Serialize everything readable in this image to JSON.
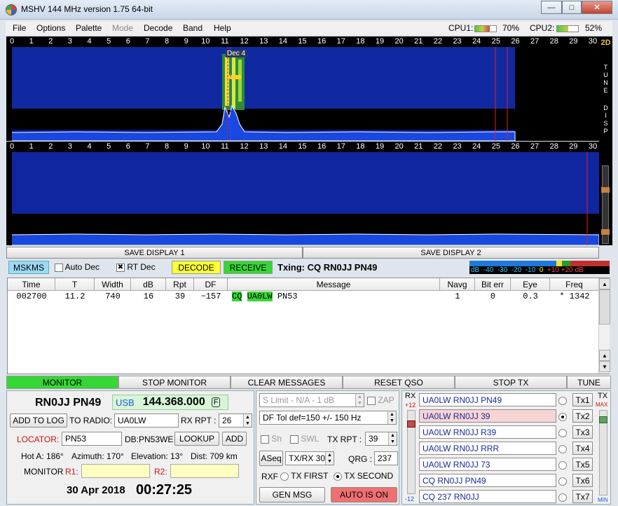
{
  "window": {
    "title": "MSHV 144 MHz version 1.75 64-bit"
  },
  "menu": [
    "File",
    "Options",
    "Palette",
    "Mode",
    "Decode",
    "Band",
    "Help"
  ],
  "cpu": {
    "cpu1_label": "CPU1:",
    "cpu1_value": "70%",
    "cpu1_level": 0.7,
    "cpu2_label": "CPU2:",
    "cpu2_value": "52%",
    "cpu2_level": 0.52
  },
  "scale": {
    "ticks": [
      "0",
      "1",
      "2",
      "3",
      "4",
      "5",
      "6",
      "7",
      "8",
      "9",
      "10",
      "11",
      "12",
      "13",
      "14",
      "15",
      "16",
      "17",
      "18",
      "19",
      "20",
      "21",
      "22",
      "23",
      "24",
      "25",
      "26",
      "27",
      "28",
      "29",
      "30"
    ]
  },
  "display1": {
    "decode_marker": "Dec 4"
  },
  "side_panel": {
    "mode_2d": "2D",
    "tune_letters": [
      "T",
      "U",
      "N",
      "E"
    ],
    "disp_letters": [
      "D",
      "I",
      "S",
      "P"
    ]
  },
  "save": {
    "display1": "SAVE DISPLAY 1",
    "display2": "SAVE DISPLAY 2"
  },
  "controls": {
    "mode": "MSKMS",
    "auto_dec": "Auto Dec",
    "auto_dec_checked": false,
    "rt_dec": "RT Dec",
    "rt_dec_checked": true,
    "decode": "DECODE",
    "receive": "RECEIVE",
    "txing": "Txing: CQ RN0JJ PN49"
  },
  "dbscale": {
    "labels": [
      "dB",
      "-40",
      "-30",
      "-20",
      "-10",
      "0",
      "+10",
      "+20 dB"
    ]
  },
  "table": {
    "headers": [
      "Time",
      "T",
      "Width",
      "dB",
      "Rpt",
      "DF",
      "Message",
      "Navg",
      "Bit err",
      "Eye",
      "Freq"
    ],
    "rows": [
      {
        "time": "002700",
        "t": "11.2",
        "width": "740",
        "db": "16",
        "rpt": "39",
        "df": "−157",
        "msg_cq": "CQ",
        "msg_call": "UA0LW",
        "msg_loc": "PN53",
        "navg": "1",
        "biterr": "0",
        "eye": "0.3",
        "freq": "* 1342"
      }
    ]
  },
  "toolbar": [
    "MONITOR",
    "STOP MONITOR",
    "CLEAR MESSAGES",
    "RESET QSO",
    "STOP TX",
    "TUNE"
  ],
  "station": {
    "call_grid": "RN0JJ PN49",
    "usb": "USB",
    "freq": "144.368.000",
    "f": "F",
    "add_to_log": "ADD TO LOG",
    "to_radio": "TO RADIO:",
    "to_radio_value": "UA0LW",
    "rx_rpt": "RX RPT :",
    "rx_rpt_value": "26",
    "locator": "LOCATOR:",
    "locator_value": "PN53",
    "db_info": "DB:PN53WE",
    "lookup": "LOOKUP",
    "add": "ADD",
    "hot_a": "Hot A: 186°",
    "azimuth": "Azimuth: 170°",
    "elevation": "Elevation: 13°",
    "dist": "Dist: 709 km",
    "monitor": "MONITOR",
    "r1": "R1:",
    "r2": "R2:",
    "date": "30 Apr 2018",
    "time": "00:27:25"
  },
  "middle": {
    "slimit": "S Limit - N/A - 1  dB",
    "zap": "ZAP",
    "dftol": "DF Tol def=150 +/-  150  Hz",
    "sh": "Sh",
    "swl": "SWL",
    "tx_rpt": "TX RPT :",
    "tx_rpt_value": "39",
    "aseq": "ASeq",
    "txrx": "TX/RX 30  s",
    "qrg": "QRG :",
    "qrg_value": "237",
    "rxf": "RXF",
    "tx_first": "TX FIRST",
    "tx_second": "TX SECOND",
    "gen_msg": "GEN MSG",
    "auto_is_on": "AUTO IS ON"
  },
  "txpanel": {
    "rx": "RX",
    "tx": "TX",
    "plus12": "+12",
    "minus12": "-12",
    "max": "MAX",
    "min": "MIN",
    "messages": [
      "UA0LW RN0JJ PN49",
      "UA0LW RN0JJ 39",
      "UA0LW RN0JJ R39",
      "UA0LW RN0JJ RRR",
      "UA0LW RN0JJ 73",
      "CQ RN0JJ PN49",
      "CQ 237 RN0JJ"
    ],
    "buttons": [
      "Tx1",
      "Tx2",
      "Tx3",
      "Tx4",
      "Tx5",
      "Tx6",
      "Tx7"
    ],
    "selected": 1
  },
  "colors": {
    "waterfall": "#081a7a",
    "green": "#36d636",
    "yellow": "#ffff33",
    "red": "#f07070",
    "mskms": "#9dd8f5"
  }
}
